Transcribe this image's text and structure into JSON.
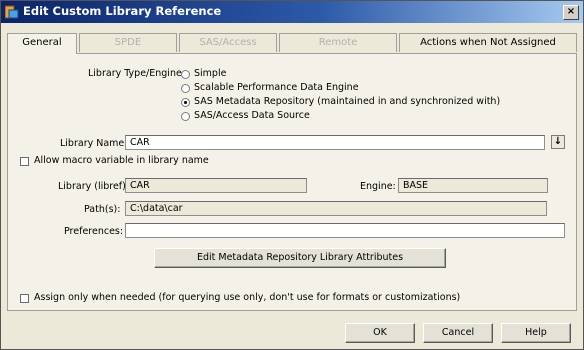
{
  "window": {
    "title": "Edit Custom Library Reference",
    "close_label": "×"
  },
  "tabs": [
    {
      "label": "General",
      "state": "active"
    },
    {
      "label": "SPDE",
      "state": "disabled"
    },
    {
      "label": "SAS/Access",
      "state": "disabled"
    },
    {
      "label": "Remote",
      "state": "disabled"
    },
    {
      "label": "Actions when Not Assigned",
      "state": "normal"
    }
  ],
  "library_type": {
    "label": "Library Type/Engine:",
    "options": [
      {
        "label": "Simple",
        "selected": false
      },
      {
        "label": "Scalable Performance Data Engine",
        "selected": false
      },
      {
        "label": "SAS Metadata Repository (maintained in and synchronized with)",
        "selected": true
      },
      {
        "label": "SAS/Access Data Source",
        "selected": false
      }
    ]
  },
  "library_name": {
    "label": "Library Name:",
    "value": "CAR",
    "dropdown_icon": "↓"
  },
  "allow_macro": {
    "label": "Allow macro variable in library name",
    "checked": false
  },
  "libref": {
    "label": "Library (libref):",
    "value": "CAR"
  },
  "engine": {
    "label": "Engine:",
    "value": "BASE"
  },
  "paths": {
    "label": "Path(s):",
    "value": "C:\\data\\car"
  },
  "preferences": {
    "label": "Preferences:",
    "value": ""
  },
  "edit_metadata_button": "Edit Metadata Repository Library Attributes",
  "assign_only": {
    "label": "Assign only when needed (for querying use only, don't use for formats or customizations)",
    "checked": false
  },
  "footer": {
    "ok": "OK",
    "cancel": "Cancel",
    "help": "Help"
  }
}
